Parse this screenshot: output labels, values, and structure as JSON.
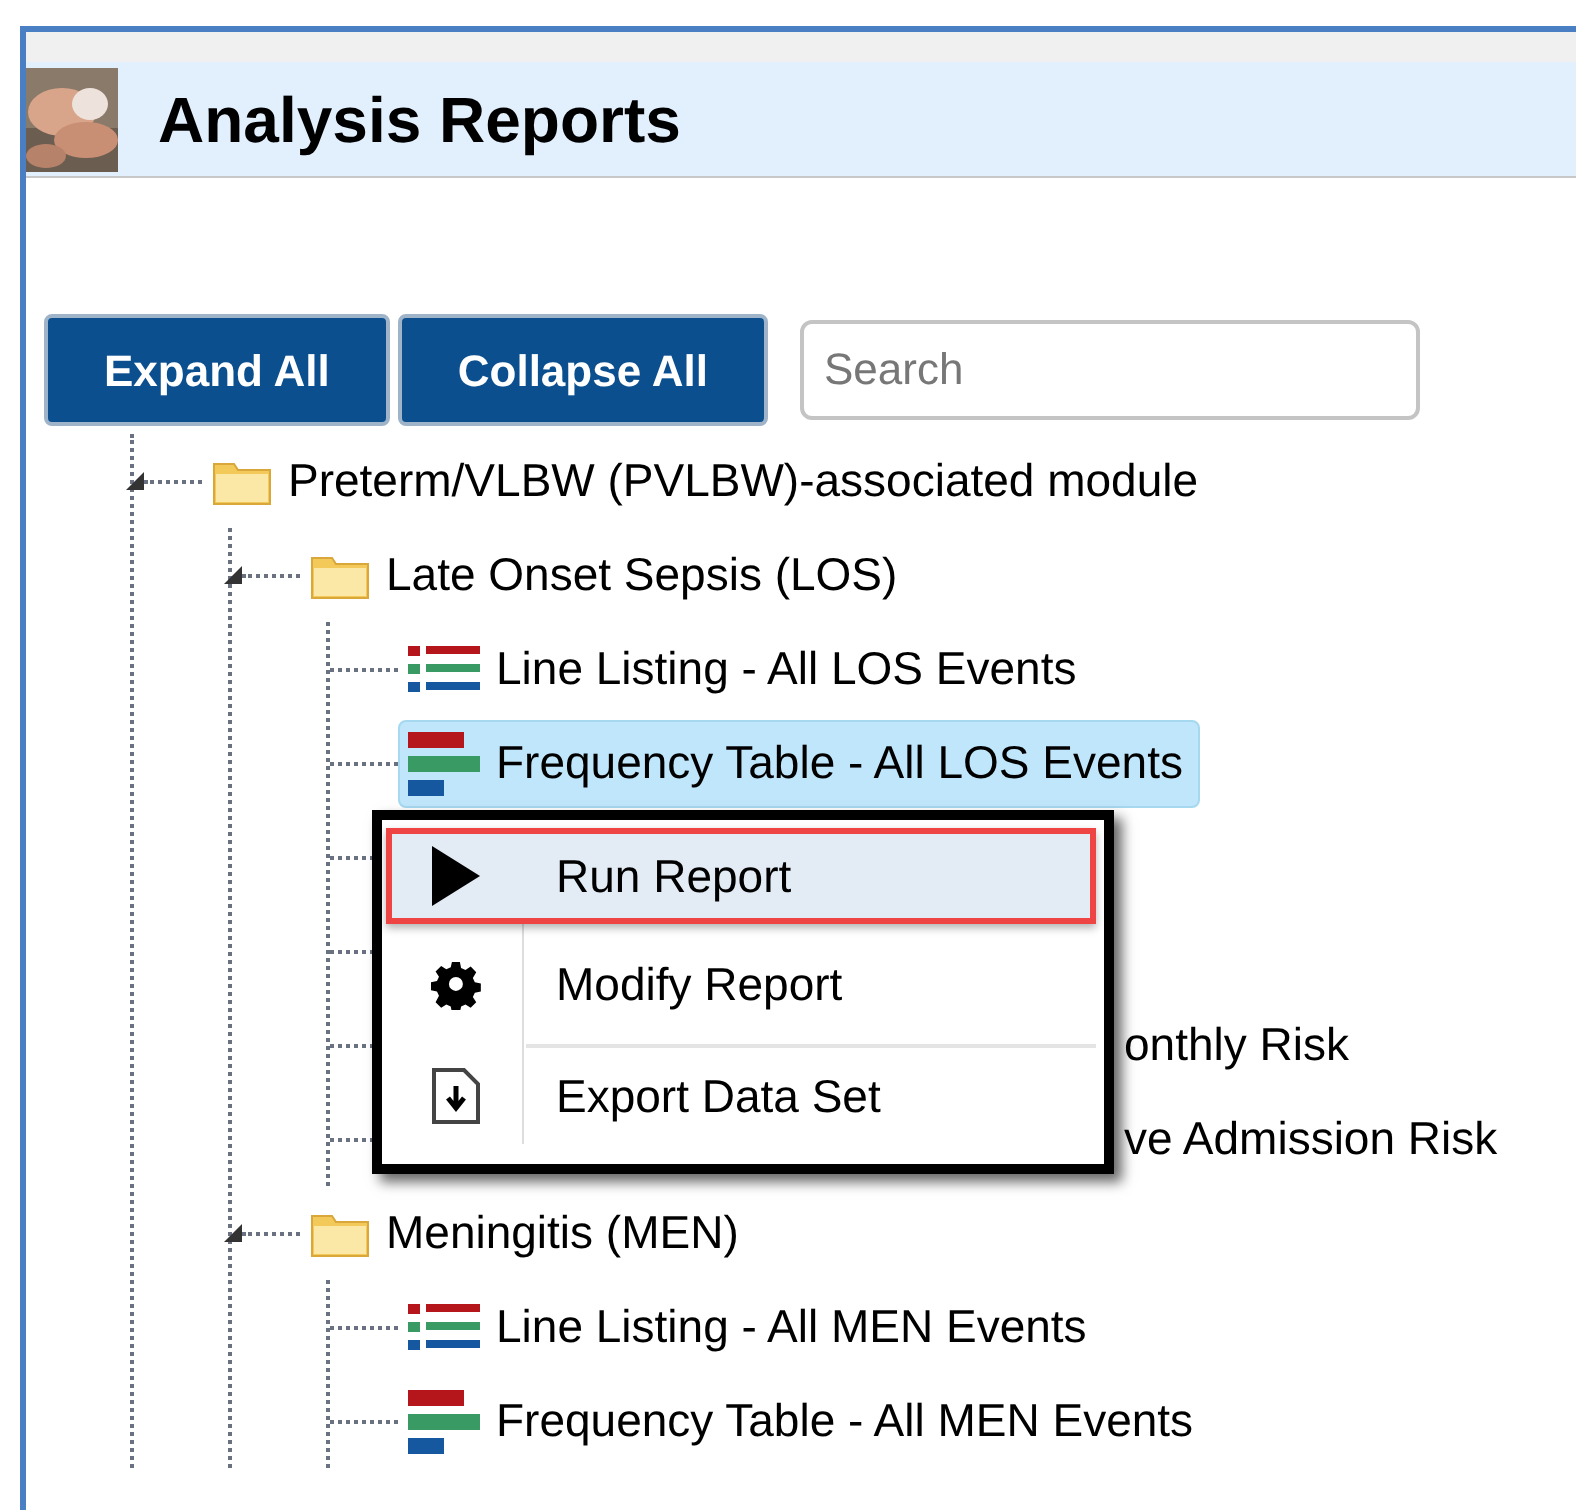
{
  "header": {
    "title": "Analysis Reports"
  },
  "toolbar": {
    "buttons": [
      "Expand All",
      "Collapse All"
    ],
    "search": {
      "placeholder": "Search"
    }
  },
  "tree": [
    {
      "kind": "folder",
      "label": "Preterm/VLBW (PVLBW)-associated module",
      "expanded": true,
      "selected": false,
      "children": [
        {
          "kind": "folder",
          "label": "Late Onset Sepsis (LOS)",
          "expanded": true,
          "selected": false,
          "children": [
            {
              "kind": "line_listing",
              "label": "Line Listing - All LOS Events",
              "selected": false
            },
            {
              "kind": "frequency_table",
              "label": "Frequency Table - All LOS Events",
              "selected": true
            },
            {
              "kind": "covered"
            },
            {
              "kind": "covered"
            },
            {
              "kind": "covered",
              "label": "onthly Risk"
            },
            {
              "kind": "covered",
              "label": "ve Admission Risk"
            }
          ]
        },
        {
          "kind": "folder",
          "label": "Meningitis (MEN)",
          "expanded": true,
          "selected": false,
          "children": [
            {
              "kind": "line_listing",
              "label": "Line Listing - All MEN Events",
              "selected": false
            },
            {
              "kind": "frequency_table",
              "label": "Frequency Table - All MEN Events",
              "selected": false
            }
          ]
        }
      ]
    }
  ],
  "context_menu": {
    "items": [
      {
        "kind": "run",
        "label": "Run Report",
        "selected": true
      },
      {
        "kind": "modify",
        "label": "Modify Report",
        "selected": false
      },
      {
        "kind": "export",
        "label": "Export Data Set",
        "selected": false
      }
    ]
  }
}
